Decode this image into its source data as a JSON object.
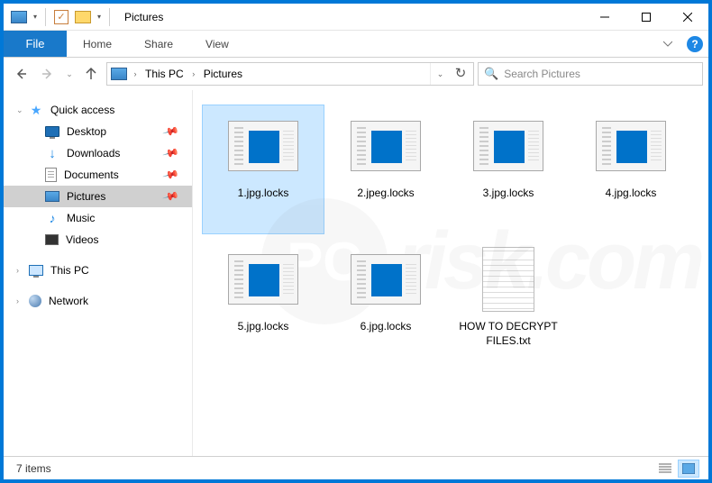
{
  "titlebar": {
    "title": "Pictures"
  },
  "ribbon": {
    "file": "File",
    "tabs": [
      "Home",
      "Share",
      "View"
    ]
  },
  "address": {
    "segments": [
      "This PC",
      "Pictures"
    ]
  },
  "search": {
    "placeholder": "Search Pictures"
  },
  "nav": {
    "quick_access": "Quick access",
    "items": [
      {
        "label": "Desktop",
        "icon": "monitor",
        "pinned": true
      },
      {
        "label": "Downloads",
        "icon": "downloads",
        "pinned": true
      },
      {
        "label": "Documents",
        "icon": "docs",
        "pinned": true
      },
      {
        "label": "Pictures",
        "icon": "pics",
        "pinned": true,
        "selected": true
      },
      {
        "label": "Music",
        "icon": "music",
        "pinned": false
      },
      {
        "label": "Videos",
        "icon": "videos",
        "pinned": false
      }
    ],
    "this_pc": "This PC",
    "network": "Network"
  },
  "files": [
    {
      "name": "1.jpg.locks",
      "thumb": "app",
      "selected": true
    },
    {
      "name": "2.jpeg.locks",
      "thumb": "app"
    },
    {
      "name": "3.jpg.locks",
      "thumb": "app"
    },
    {
      "name": "4.jpg.locks",
      "thumb": "app"
    },
    {
      "name": "5.jpg.locks",
      "thumb": "app"
    },
    {
      "name": "6.jpg.locks",
      "thumb": "app"
    },
    {
      "name": "HOW TO DECRYPT FILES.txt",
      "thumb": "txt"
    }
  ],
  "status": {
    "text": "7 items"
  }
}
